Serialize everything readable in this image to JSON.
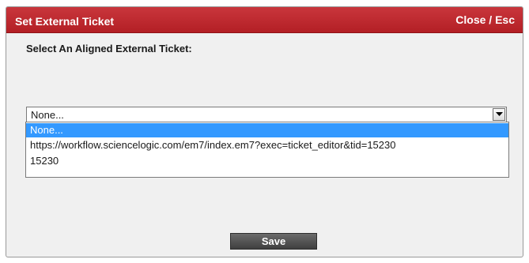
{
  "dialog": {
    "title": "Set External Ticket",
    "close_label": "Close / Esc",
    "prompt": "Select An Aligned External Ticket:",
    "select": {
      "selected_value": "None..."
    },
    "options": [
      {
        "label": "None...",
        "selected": true
      },
      {
        "label": "https://workflow.sciencelogic.com/em7/index.em7?exec=ticket_editor&tid=15230",
        "selected": false
      },
      {
        "label": "15230",
        "selected": false
      }
    ],
    "save_label": "Save"
  },
  "colors": {
    "titlebar": "#b31f25",
    "selected_option": "#3399ff",
    "save_button": "#4a4a4a",
    "dialog_bg": "#f0f0f0"
  },
  "icons": {
    "dropdown_arrow": "chevron-down-icon"
  }
}
